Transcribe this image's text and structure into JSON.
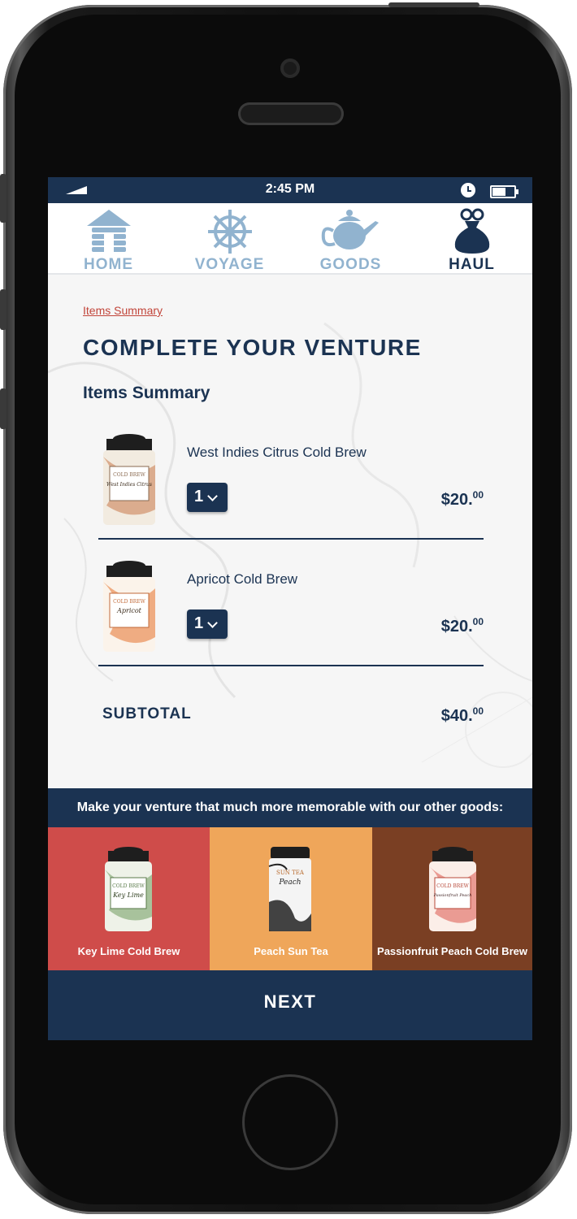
{
  "status_bar": {
    "time": "2:45 PM"
  },
  "nav": {
    "items": [
      {
        "label": "HOME",
        "icon": "cabin-icon"
      },
      {
        "label": "VOYAGE",
        "icon": "ship-wheel-icon"
      },
      {
        "label": "GOODS",
        "icon": "teapot-icon"
      },
      {
        "label": "HAUL",
        "icon": "sack-icon"
      }
    ],
    "active_index": 3
  },
  "breadcrumb": "Items Summary",
  "page_title": "COMPLETE YOUR VENTURE",
  "section_title": "Items Summary",
  "cart": {
    "items": [
      {
        "name": "West Indies Citrus Cold Brew",
        "quantity": "1",
        "price_main": "$20.",
        "price_cents": "00",
        "tin_label_top": "COLD BREW",
        "tin_label_name": "West Indies Citrus",
        "tin_accent": "#c9784a"
      },
      {
        "name": "Apricot Cold Brew",
        "quantity": "1",
        "price_main": "$20.",
        "price_cents": "00",
        "tin_label_top": "COLD BREW",
        "tin_label_name": "Apricot",
        "tin_accent": "#e8864a"
      }
    ],
    "subtotal_label": "SUBTOTAL",
    "subtotal_main": "$40.",
    "subtotal_cents": "00"
  },
  "upsell": {
    "banner": "Make your venture that much more memorable with our other goods:",
    "products": [
      {
        "label": "Key Lime Cold Brew",
        "bg": "#cf4c4a",
        "tin_label_top": "COLD BREW",
        "tin_label_name": "Key Lime",
        "tin_accent": "#6f9a5c"
      },
      {
        "label": "Peach Sun Tea",
        "bg": "#efa65a",
        "tin_label_top": "SUN TEA",
        "tin_label_name": "Peach",
        "tin_accent": "#222222"
      },
      {
        "label": "Passionfruit Peach Cold Brew",
        "bg": "#7a3f23",
        "tin_label_top": "COLD BREW",
        "tin_label_name": "Passionfruit Peach",
        "tin_accent": "#e0645a"
      }
    ]
  },
  "next_button": "NEXT",
  "colors": {
    "navy": "#1b3352",
    "nav_inactive": "#91b3cf",
    "link_red": "#c2453a"
  }
}
